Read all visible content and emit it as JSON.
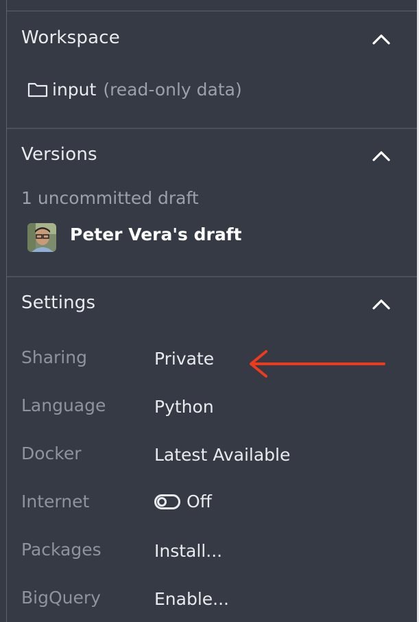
{
  "workspace": {
    "title": "Workspace",
    "folder_name": "input",
    "folder_note": "(read-only data)"
  },
  "versions": {
    "title": "Versions",
    "draft_count": "1 uncommitted draft",
    "draft_name": "Peter Vera's draft"
  },
  "settings": {
    "title": "Settings",
    "rows": [
      {
        "label": "Sharing",
        "value": "Private"
      },
      {
        "label": "Language",
        "value": "Python"
      },
      {
        "label": "Docker",
        "value": "Latest Available"
      },
      {
        "label": "Internet",
        "value": "Off"
      },
      {
        "label": "Packages",
        "value": "Install..."
      },
      {
        "label": "BigQuery",
        "value": "Enable..."
      }
    ]
  },
  "icons": {
    "collapse": "chevron-up-icon",
    "folder": "folder-icon",
    "toggle": "toggle-off-icon",
    "annotation": "arrow-left-icon"
  },
  "colors": {
    "background": "#353a45",
    "annotation_arrow": "#f03a1c"
  }
}
